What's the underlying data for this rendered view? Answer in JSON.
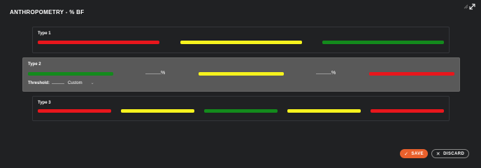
{
  "header": {
    "title": "ANTHROPOMETRY - % BF"
  },
  "type1": {
    "title": "Type 1",
    "bars": [
      "red",
      "yellow",
      "green"
    ]
  },
  "type2": {
    "title": "Type 2",
    "bars": [
      "green",
      "yellow",
      "red"
    ],
    "pct_symbol": "%",
    "threshold_label": "Threshold:",
    "threshold_value": "",
    "threshold_select": "Custom"
  },
  "type3": {
    "title": "Type 3",
    "bars": [
      "red",
      "yellow",
      "green",
      "yellow",
      "red"
    ]
  },
  "actions": {
    "save_label": "SAVE",
    "discard_label": "DISCARD"
  },
  "colors": {
    "red": "#e8161c",
    "yellow": "#f5f21e",
    "green": "#138a1c",
    "accent": "#e9602c",
    "background": "#202123",
    "selected_panel": "#595959"
  },
  "icons": [
    "minimize-icon",
    "collapse-icon",
    "check-icon",
    "close-icon",
    "chevron-down-icon"
  ]
}
